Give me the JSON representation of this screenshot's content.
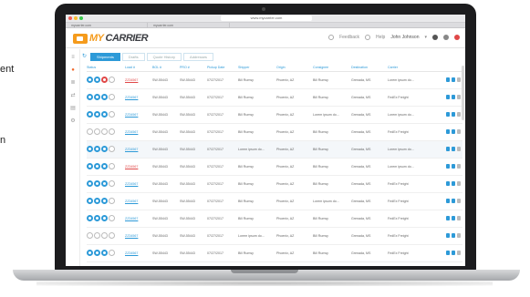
{
  "page": {
    "side_text_1": "ent",
    "side_text_2": "n"
  },
  "browser": {
    "url": "www.mycarrier.com",
    "tabs": [
      "mycarrier.com",
      "mycarrier.com"
    ],
    "traffic_colors": [
      "#f25f58",
      "#fbbe2e",
      "#38c94a"
    ]
  },
  "app": {
    "logo_my": "MY",
    "logo_carrier": "CARRIER",
    "header": {
      "feedback": "Feedback",
      "help": "Help",
      "user": "John Johnson"
    },
    "accent": "#2d9ad8",
    "brand": "#f59b1c",
    "filter_tabs": [
      "Shipments",
      "Drafts",
      "Quote History",
      "Addresses"
    ],
    "columns": [
      "Status",
      "Load #",
      "BOL #",
      "PRO #",
      "Pickup Date",
      "Shipper",
      "Origin",
      "Consignee",
      "Destination",
      "Carrier",
      ""
    ],
    "rows": [
      {
        "status": [
          "#2d9ad8",
          "#2d9ad8",
          "#e04848",
          "o"
        ],
        "load": "ZZ34567",
        "alert": true,
        "bol": "SW-55443",
        "pro": "SW-55443",
        "date": "07/27/2017",
        "shipper": "Bill Rumsy",
        "origin": "Phoenix, AZ",
        "consignee": "Bill Rumsy",
        "dest": "Grenada, MS",
        "carrier": "Lorem ipsum do...",
        "hl": false
      },
      {
        "status": [
          "#2d9ad8",
          "#2d9ad8",
          "#2d9ad8",
          "o"
        ],
        "load": "ZZ34567",
        "alert": false,
        "bol": "SW-55443",
        "pro": "SW-55443",
        "date": "07/27/2017",
        "shipper": "Bill Rumsy",
        "origin": "Phoenix, AZ",
        "consignee": "Bill Rumsy",
        "dest": "Grenada, MS",
        "carrier": "FedEx Freight",
        "hl": false
      },
      {
        "status": [
          "#2d9ad8",
          "#2d9ad8",
          "#2d9ad8",
          "o"
        ],
        "load": "ZZ34567",
        "alert": false,
        "bol": "SW-55443",
        "pro": "SW-55443",
        "date": "07/27/2017",
        "shipper": "Bill Rumsy",
        "origin": "Phoenix, AZ",
        "consignee": "Lorem ipsum do...",
        "dest": "Grenada, MS",
        "carrier": "Lorem ipsum do...",
        "hl": false
      },
      {
        "status": [
          "o",
          "o",
          "o",
          "o"
        ],
        "load": "ZZ34567",
        "alert": false,
        "bol": "SW-55443",
        "pro": "SW-55443",
        "date": "07/27/2017",
        "shipper": "Bill Rumsy",
        "origin": "Phoenix, AZ",
        "consignee": "Bill Rumsy",
        "dest": "Grenada, MS",
        "carrier": "FedEx Freight",
        "hl": false
      },
      {
        "status": [
          "#2d9ad8",
          "#2d9ad8",
          "#2d9ad8",
          "o"
        ],
        "load": "ZZ34567",
        "alert": false,
        "bol": "SW-55443",
        "pro": "SW-55443",
        "date": "07/27/2017",
        "shipper": "Lorem ipsum do...",
        "origin": "Phoenix, AZ",
        "consignee": "Bill Rumsy",
        "dest": "Grenada, MS",
        "carrier": "Lorem ipsum do...",
        "hl": true
      },
      {
        "status": [
          "#2d9ad8",
          "#2d9ad8",
          "#2d9ad8",
          "o"
        ],
        "load": "ZZ34567",
        "alert": true,
        "bol": "SW-55443",
        "pro": "SW-55443",
        "date": "07/27/2017",
        "shipper": "Bill Rumsy",
        "origin": "Phoenix, AZ",
        "consignee": "Bill Rumsy",
        "dest": "Grenada, MS",
        "carrier": "Lorem ipsum do...",
        "hl": false
      },
      {
        "status": [
          "#2d9ad8",
          "#2d9ad8",
          "#2d9ad8",
          "o"
        ],
        "load": "ZZ34567",
        "alert": false,
        "bol": "SW-55443",
        "pro": "SW-55443",
        "date": "07/27/2017",
        "shipper": "Bill Rumsy",
        "origin": "Phoenix, AZ",
        "consignee": "Bill Rumsy",
        "dest": "Grenada, MS",
        "carrier": "FedEx Freight",
        "hl": false
      },
      {
        "status": [
          "#2d9ad8",
          "#2d9ad8",
          "#2d9ad8",
          "o"
        ],
        "load": "ZZ34567",
        "alert": false,
        "bol": "SW-55443",
        "pro": "SW-55443",
        "date": "07/27/2017",
        "shipper": "Bill Rumsy",
        "origin": "Phoenix, AZ",
        "consignee": "Lorem ipsum do...",
        "dest": "Grenada, MS",
        "carrier": "FedEx Freight",
        "hl": false
      },
      {
        "status": [
          "#2d9ad8",
          "#2d9ad8",
          "#2d9ad8",
          "o"
        ],
        "load": "ZZ34567",
        "alert": false,
        "bol": "SW-55443",
        "pro": "SW-55443",
        "date": "07/27/2017",
        "shipper": "Bill Rumsy",
        "origin": "Phoenix, AZ",
        "consignee": "Bill Rumsy",
        "dest": "Grenada, MS",
        "carrier": "FedEx Freight",
        "hl": false
      },
      {
        "status": [
          "o",
          "o",
          "o",
          "o"
        ],
        "load": "ZZ34567",
        "alert": false,
        "bol": "SW-55443",
        "pro": "SW-55443",
        "date": "07/27/2017",
        "shipper": "Lorem ipsum do...",
        "origin": "Phoenix, AZ",
        "consignee": "Bill Rumsy",
        "dest": "Grenada, MS",
        "carrier": "FedEx Freight",
        "hl": false
      },
      {
        "status": [
          "#2d9ad8",
          "#2d9ad8",
          "#2d9ad8",
          "o"
        ],
        "load": "ZZ34567",
        "alert": false,
        "bol": "SW-55443",
        "pro": "SW-55443",
        "date": "07/27/2017",
        "shipper": "Bill Rumsy",
        "origin": "Phoenix, AZ",
        "consignee": "Bill Rumsy",
        "dest": "Grenada, MS",
        "carrier": "FedEx Freight",
        "hl": false
      }
    ]
  }
}
